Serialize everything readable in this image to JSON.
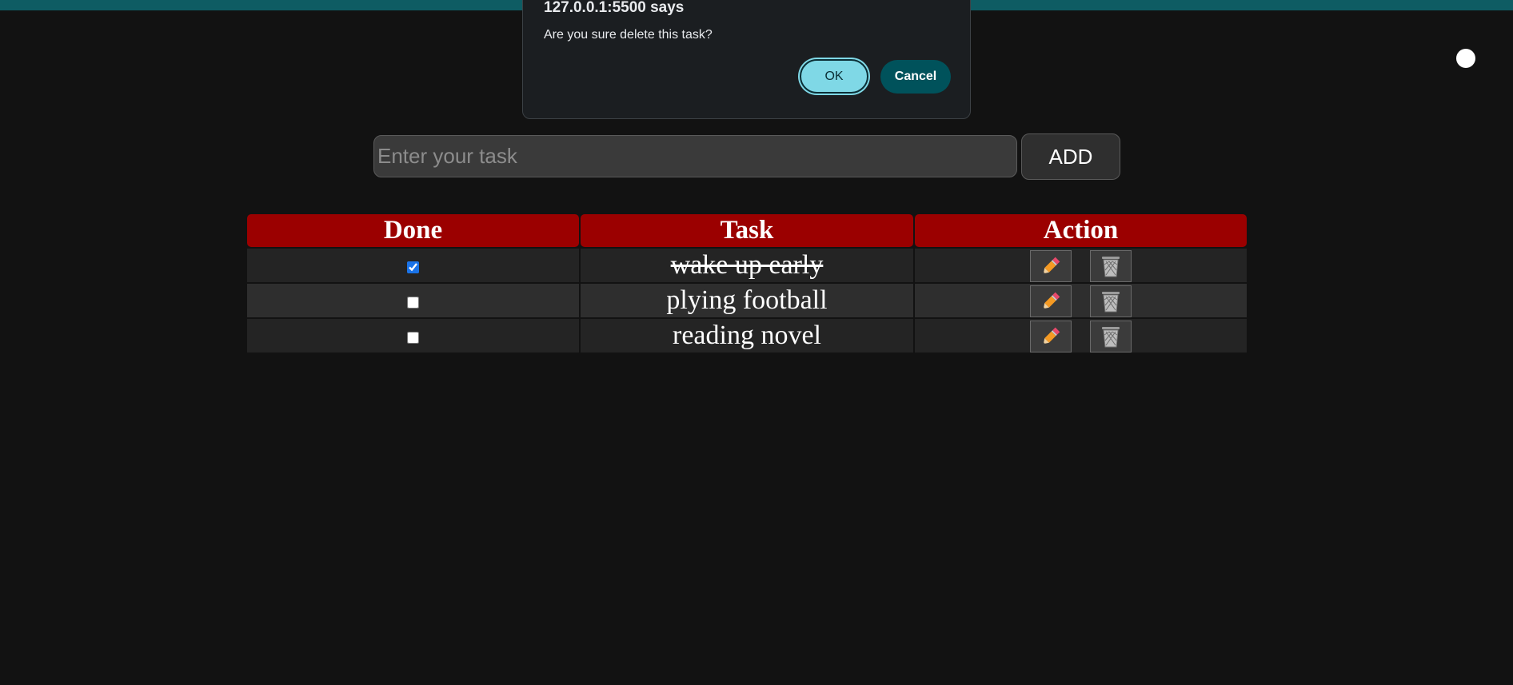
{
  "dialog": {
    "title": "127.0.0.1:5500 says",
    "message": "Are you sure delete this task?",
    "ok_label": "OK",
    "cancel_label": "Cancel"
  },
  "form": {
    "input_value": "",
    "input_placeholder": "Enter your task",
    "add_label": "ADD"
  },
  "table": {
    "headers": [
      "Done",
      "Task",
      "Action"
    ],
    "rows": [
      {
        "done": true,
        "task": "wake up early"
      },
      {
        "done": false,
        "task": "plying football"
      },
      {
        "done": false,
        "task": "reading novel"
      }
    ],
    "row_actions": [
      {
        "icon": "pencil-icon",
        "label": "edit"
      },
      {
        "icon": "trash-icon",
        "label": "delete"
      }
    ]
  },
  "colors": {
    "header_bg": "#9b0000",
    "top_strip": "#0e5c63",
    "ok_button": "#7fd8e6",
    "cancel_button": "#00525b",
    "page_bg": "#121212"
  },
  "theme_toggle": {
    "icon": "theme-toggle-dot-icon"
  }
}
